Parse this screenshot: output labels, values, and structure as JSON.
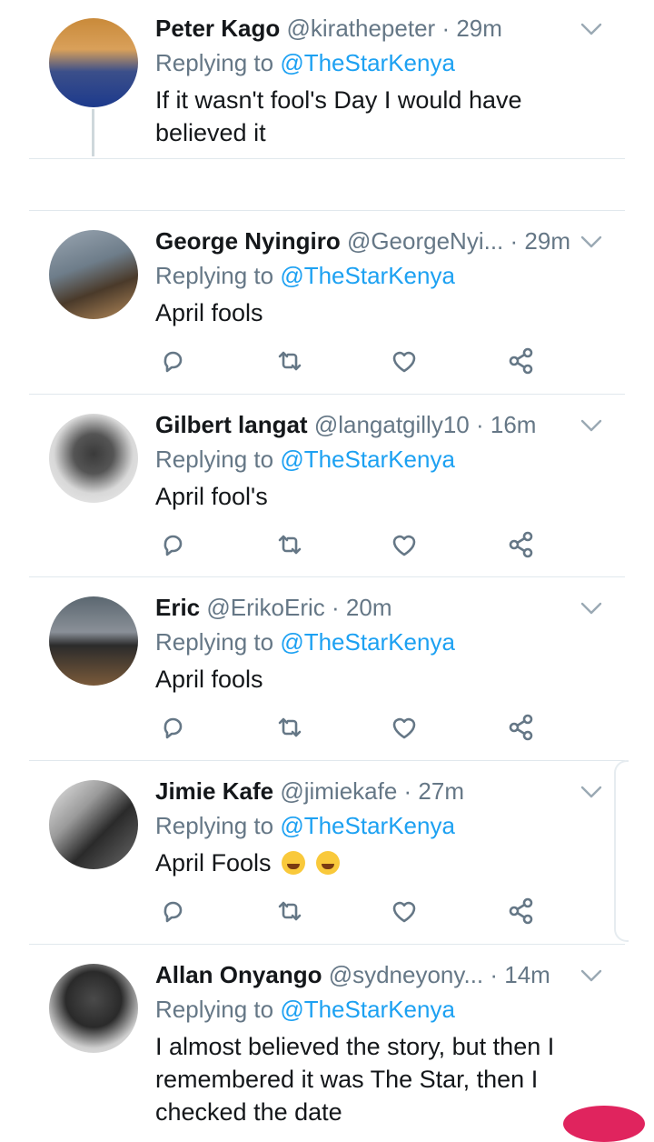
{
  "tweets": [
    {
      "name": "Peter Kago",
      "handle": "@kirathepeter",
      "time": "· 29m",
      "replying_prefix": "Replying to",
      "replying_to": "@TheStarKenya",
      "text": "If it wasn't fool's Day I would have believed it"
    },
    {
      "name": "George Nyingiro",
      "handle": "@GeorgeNyi...",
      "time": "· 29m",
      "replying_prefix": "Replying to",
      "replying_to": "@TheStarKenya",
      "text": "April fools"
    },
    {
      "name": "Gilbert langat",
      "handle": "@langatgilly10",
      "time": "· 16m",
      "replying_prefix": "Replying to",
      "replying_to": "@TheStarKenya",
      "text": "April fool's"
    },
    {
      "name": "Eric",
      "handle": "@ErikoEric",
      "time": "· 20m",
      "replying_prefix": "Replying to",
      "replying_to": "@TheStarKenya",
      "text": "April fools"
    },
    {
      "name": "Jimie Kafe",
      "handle": "@jimiekafe",
      "time": "· 27m",
      "replying_prefix": "Replying to",
      "replying_to": "@TheStarKenya",
      "text": "April Fools",
      "emoji": [
        "face-with-tears-of-joy",
        "face-with-tears-of-joy"
      ]
    },
    {
      "name": "Allan Onyango",
      "handle": "@sydneyony...",
      "time": "· 14m",
      "replying_prefix": "Replying to",
      "replying_to": "@TheStarKenya",
      "text": "I almost believed the story, but then I remembered it was The Star, then I checked the date"
    }
  ],
  "icons": {
    "reply": "reply-icon",
    "retweet": "retweet-icon",
    "like": "like-icon",
    "share": "share-icon",
    "menu": "chevron-down-icon"
  },
  "colors": {
    "name": "#14171a",
    "secondary": "#657786",
    "mention": "#1da1f2",
    "divider": "#e1e8ed",
    "icon": "#657786"
  }
}
